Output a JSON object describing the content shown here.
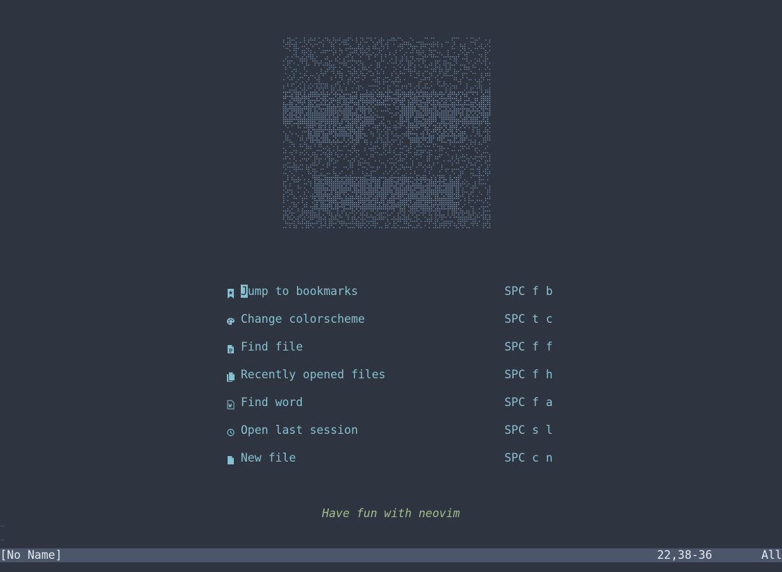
{
  "menu": {
    "items": [
      {
        "icon": "bookmark-icon",
        "label": "Jump to bookmarks",
        "shortcut": "SPC f b"
      },
      {
        "icon": "palette-icon",
        "label": "Change colorscheme",
        "shortcut": "SPC t c"
      },
      {
        "icon": "file-icon",
        "label": "Find file",
        "shortcut": "SPC f f"
      },
      {
        "icon": "files-icon",
        "label": "Recently opened files",
        "shortcut": "SPC f h"
      },
      {
        "icon": "word-file-icon",
        "label": "Find word",
        "shortcut": "SPC f a"
      },
      {
        "icon": "history-icon",
        "label": "Open last session",
        "shortcut": "SPC s l"
      },
      {
        "icon": "new-file-icon",
        "label": "New file",
        "shortcut": "SPC c n"
      }
    ],
    "first_label_rest": "ump to bookmarks",
    "first_label_cursor_char": "J"
  },
  "footer": {
    "text": "Have fun with neovim"
  },
  "buffer": {
    "tilde": "~"
  },
  "statusline": {
    "filename": "[No Name]",
    "position": "22,38-36",
    "scroll": "All"
  },
  "colors": {
    "background": "#2e3440",
    "accent": "#88c0d0",
    "footer": "#a3be8c",
    "statusline_bg": "#4c566a",
    "statusline_fg": "#e5e9f0",
    "banner": "#81a1c1"
  }
}
